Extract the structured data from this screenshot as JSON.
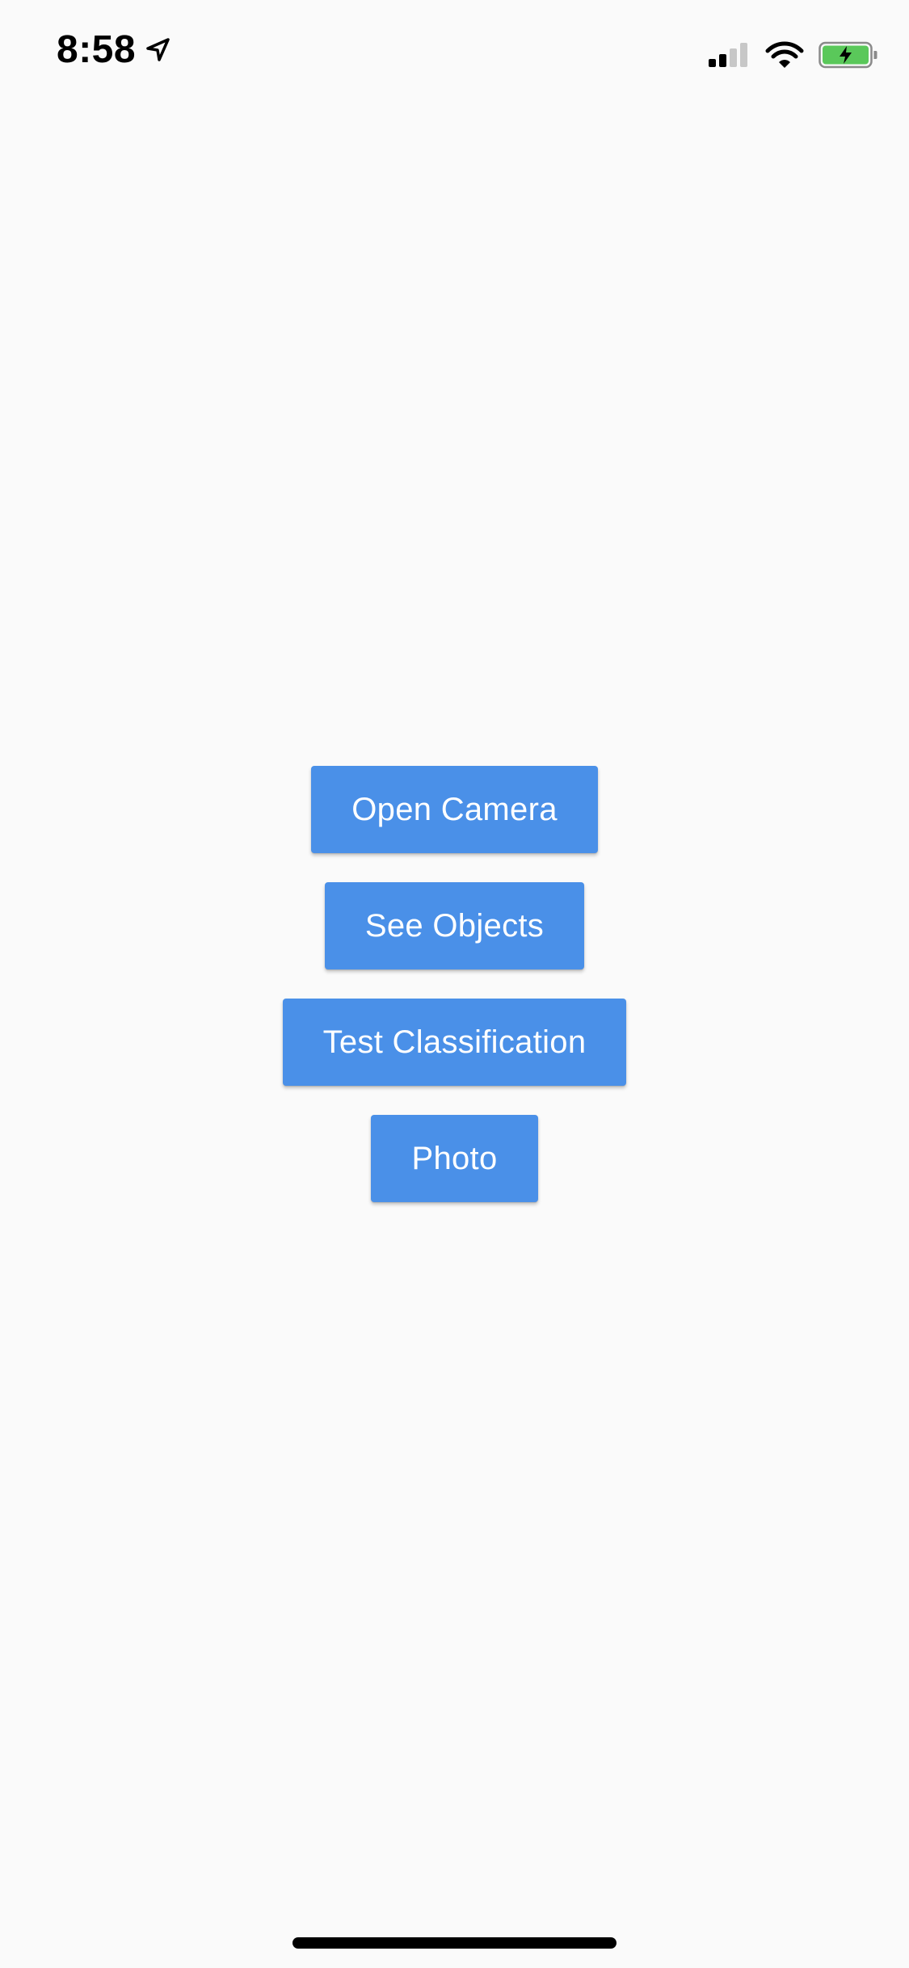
{
  "status_bar": {
    "time": "8:58",
    "location_icon": "location-arrow-icon",
    "signal_icon": "cellular-signal-icon",
    "wifi_icon": "wifi-icon",
    "battery_icon": "battery-charging-icon"
  },
  "colors": {
    "background": "#fafafa",
    "button": "#4a90e8",
    "button_text": "#ffffff",
    "battery_fill": "#5ac85a"
  },
  "buttons": [
    {
      "label": "Open Camera"
    },
    {
      "label": "See Objects"
    },
    {
      "label": "Test Classification"
    },
    {
      "label": "Photo"
    }
  ]
}
